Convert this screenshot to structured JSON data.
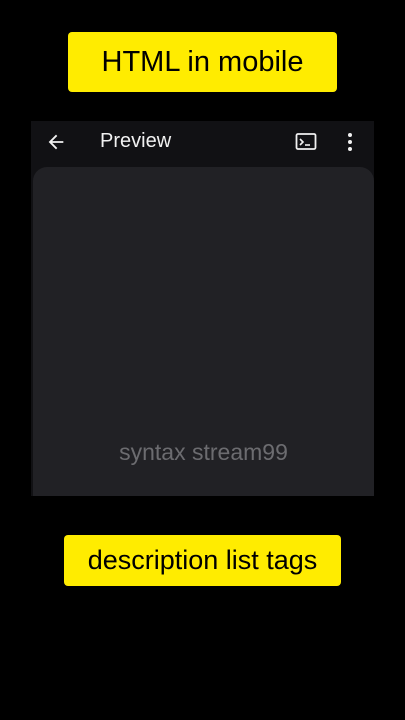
{
  "banners": {
    "top": "HTML in mobile",
    "bottom": "description list tags"
  },
  "appbar": {
    "title": "Preview",
    "icons": [
      "back-arrow-icon",
      "terminal-icon",
      "more-vert-icon"
    ]
  },
  "preview": {
    "watermark": "syntax stream99"
  },
  "colors": {
    "banner_background": "#ffec00",
    "background": "#000000",
    "appbar": "#111114",
    "content": "#212125",
    "watermark": "#6c6c70"
  }
}
